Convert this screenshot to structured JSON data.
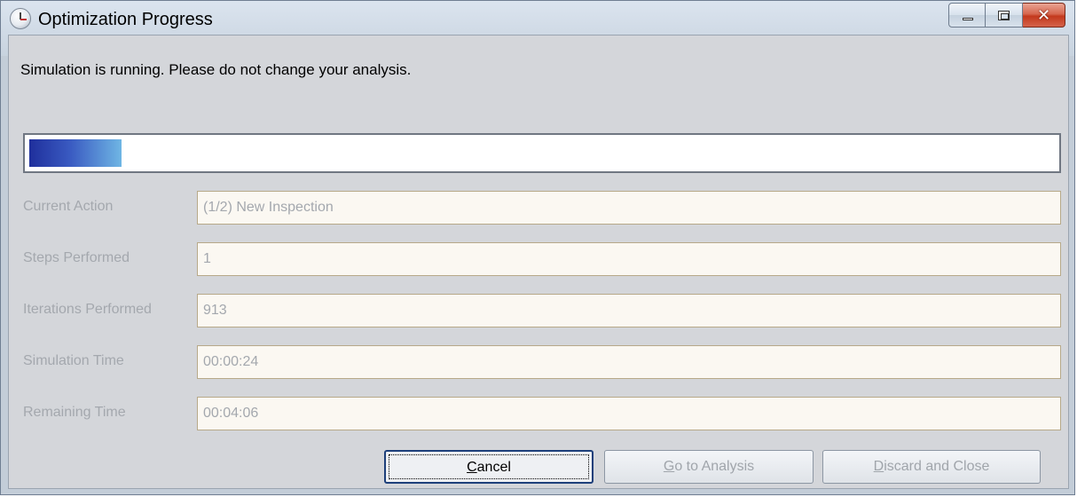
{
  "window": {
    "title": "Optimization Progress",
    "icon": "stopwatch-icon",
    "controls": {
      "minimize": "minimize-icon",
      "maximize": "maximize-icon",
      "close_glyph": "✕"
    }
  },
  "message": "Simulation is running. Please do not change your analysis.",
  "progress": {
    "fraction": 0.09
  },
  "fields": [
    {
      "label": "Current Action",
      "value": "(1/2) New Inspection"
    },
    {
      "label": "Steps Performed",
      "value": "1"
    },
    {
      "label": "Iterations Performed",
      "value": "913"
    },
    {
      "label": "Simulation Time",
      "value": "00:00:24"
    },
    {
      "label": "Remaining Time",
      "value": "00:04:06"
    }
  ],
  "buttons": {
    "cancel": {
      "mnemonic": "C",
      "rest": "ancel"
    },
    "go_to_analysis": {
      "mnemonic": "G",
      "rest": "o to Analysis"
    },
    "discard_and_close": {
      "mnemonic": "D",
      "rest": "iscard and Close"
    }
  },
  "colors": {
    "progress_start": "#1f2f9c",
    "progress_end": "#6fb6e4",
    "disabled_text": "#a4a8ae",
    "close_button": "#c3391d"
  }
}
